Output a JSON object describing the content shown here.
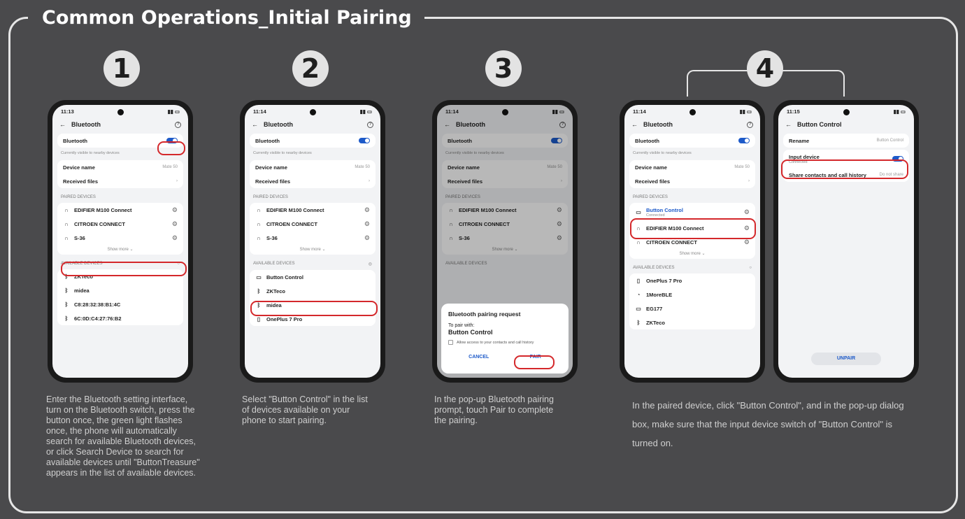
{
  "title": "Common Operations_Initial Pairing",
  "steps": [
    "1",
    "2",
    "3",
    "4"
  ],
  "common": {
    "bluetooth": "Bluetooth",
    "visible": "Currently visible to nearby devices",
    "device_name": "Device name",
    "device_name_val": "Mate 50",
    "received": "Received files",
    "paired": "PAIRED DEVICES",
    "available": "AVAILABLE DEVICES",
    "show_more": "Show more",
    "edifier": "EDIFIER M100 Connect",
    "citroen": "CITROEN CONNECT",
    "s36": "S-36",
    "zkteco": "ZKTeco",
    "midea": "midea",
    "button_control": "Button Control",
    "oneplus": "OnePlus 7 Pro",
    "connected": "Connected"
  },
  "phone1": {
    "time": "11:13",
    "avail": [
      "C8:28:32:38:B1:4C",
      "6C:0D:C4:27:76:B2"
    ]
  },
  "phone2": {
    "time": "11:14"
  },
  "phone3": {
    "time": "11:14",
    "dialog_title": "Bluetooth pairing request",
    "to_pair": "To pair with:",
    "allow": "Allow access to your contacts and call history",
    "cancel": "CANCEL",
    "pair": "PAIR"
  },
  "phone4": {
    "time": "11:14",
    "avail": [
      "1MoreBLE",
      "EG177"
    ]
  },
  "phone5": {
    "time": "11:15",
    "title": "Button Control",
    "rename": "Rename",
    "input": "Input device",
    "share": "Share contacts and call history",
    "share_val": "Do not share",
    "unpair": "UNPAIR"
  },
  "desc": {
    "d1": "Enter the Bluetooth setting interface, turn on the Bluetooth switch, press the button once, the green light flashes once, the phone will automatically search for available Bluetooth devices, or click Search Device to search for available devices until \"ButtonTreasure\" appears in the list of available devices.",
    "d2": "Select \"Button Control\" in the list of devices available on your phone to start pairing.",
    "d3": "In the pop-up Bluetooth pairing prompt, touch Pair to complete the pairing.",
    "d4": "In the paired device, click \"Button Control\", and in the pop-up dialog box, make sure that the input device switch of \"Button Control\" is turned on."
  }
}
